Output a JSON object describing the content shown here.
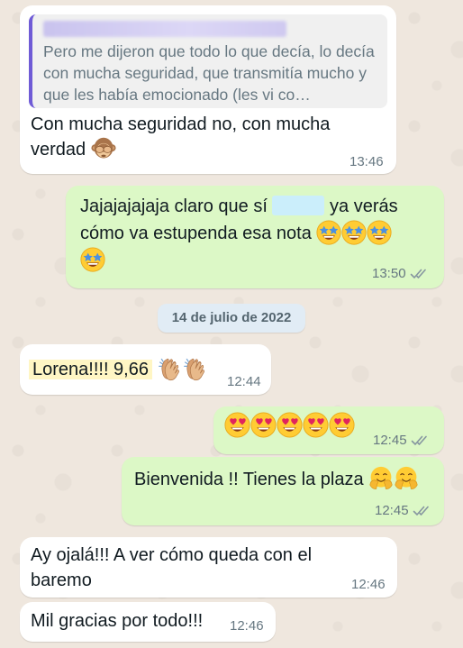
{
  "chat": {
    "messages": [
      {
        "direction": "incoming",
        "quoted_text": "Pero me dijeron que todo lo que decía, lo decía con mucha seguridad, que transmitía mucho y que les había emocionado (les vi co…",
        "text_line1": "Con mucha seguridad no, con mucha",
        "text_line2": "verdad",
        "emoji": "see-no-evil-monkey",
        "time": "13:46"
      },
      {
        "direction": "outgoing",
        "text_line1_a": "Jajajajajaja claro que sí",
        "text_line1_b": "ya verás",
        "text_line2": "cómo va estupenda esa nota",
        "emoji": "star-struck-face",
        "time": "13:50",
        "status": "read"
      },
      {
        "direction": "incoming",
        "text": "Lorena!!!! 9,66",
        "emoji": "clapping-hands",
        "time": "12:44"
      },
      {
        "direction": "outgoing",
        "emoji": "heart-eyes-face",
        "time": "12:45",
        "status": "read"
      },
      {
        "direction": "outgoing",
        "text": "Bienvenida !! Tienes la plaza",
        "emoji": "hugging-face",
        "time": "12:45",
        "status": "read"
      },
      {
        "direction": "incoming",
        "text_line1": "Ay ojalá!!! A ver cómo queda con el",
        "text_line2": "baremo",
        "time": "12:46"
      },
      {
        "direction": "incoming",
        "text": "Mil gracias por todo!!!",
        "time": "12:46"
      }
    ],
    "date_separator": "14 de julio de 2022"
  },
  "colors": {
    "incoming_bubble": "#ffffff",
    "outgoing_bubble": "#dcf8c6",
    "quote_bar": "#6f5bd6",
    "read_ticks": "#53bdeb",
    "date_pill": "#e1ecf5"
  }
}
